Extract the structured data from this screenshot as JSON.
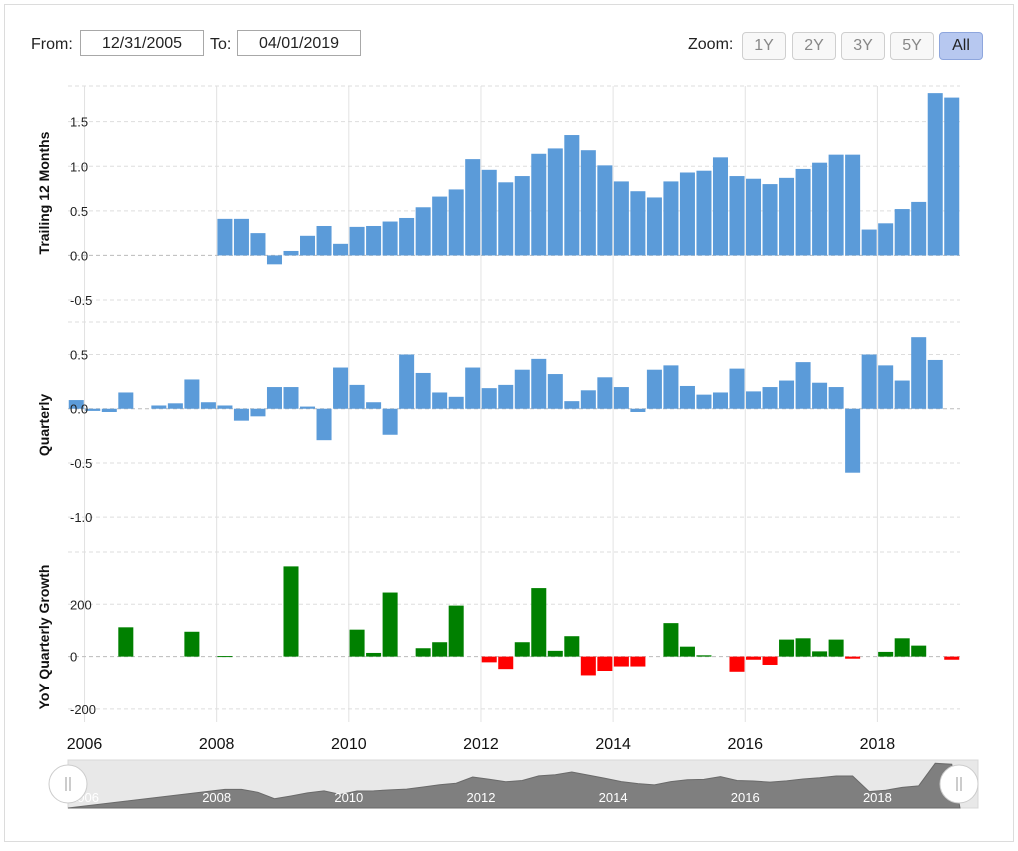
{
  "range": {
    "from_label": "From:",
    "from_value": "12/31/2005",
    "to_label": "To:",
    "to_value": "04/01/2019"
  },
  "zoom": {
    "label": "Zoom:",
    "buttons": [
      "1Y",
      "2Y",
      "3Y",
      "5Y",
      "All"
    ],
    "selected": "All"
  },
  "colors": {
    "blue_bars": "#5b9bd9",
    "positive": "#008000",
    "negative": "#ff0000",
    "grid": "#dddddd",
    "navigator_area": "#7f7f7f"
  },
  "chart_data": {
    "type": "bar",
    "x_start_year": 2005.75,
    "x_end_year": 2019.25,
    "bar_step_years": 0.25,
    "x_ticks": [
      "2006",
      "2008",
      "2010",
      "2012",
      "2014",
      "2016",
      "2018"
    ],
    "panels": [
      {
        "ylabel": "Trailing 12 Months",
        "ylim": [
          -0.5,
          1.9
        ],
        "yticks": [
          1.5,
          1.0,
          0.5,
          0.0,
          -0.5
        ],
        "ytick_labels": [
          "1.5",
          "1.0",
          "0.5",
          "0.0",
          "-0.5"
        ],
        "values": [
          null,
          null,
          null,
          null,
          null,
          null,
          null,
          null,
          null,
          0.41,
          0.41,
          0.25,
          -0.1,
          0.05,
          0.22,
          0.33,
          0.13,
          0.32,
          0.33,
          0.38,
          0.42,
          0.54,
          0.66,
          0.74,
          1.08,
          0.96,
          0.82,
          0.89,
          1.14,
          1.2,
          1.35,
          1.18,
          1.01,
          0.83,
          0.72,
          0.65,
          0.83,
          0.93,
          0.95,
          1.1,
          0.89,
          0.86,
          0.8,
          0.87,
          0.97,
          1.04,
          1.13,
          1.13,
          0.29,
          0.36,
          0.52,
          0.6,
          1.82,
          1.77
        ]
      },
      {
        "ylabel": "Quarterly",
        "ylim": [
          -1.1,
          0.8
        ],
        "yticks": [
          0.5,
          0.0,
          -0.5,
          -1.0
        ],
        "ytick_labels": [
          "0.5",
          "0.0",
          "-0.5",
          "-1.0"
        ],
        "values": [
          0.08,
          -0.02,
          -0.03,
          0.15,
          null,
          0.03,
          0.05,
          0.27,
          0.06,
          0.03,
          -0.11,
          -0.07,
          0.2,
          0.2,
          0.02,
          -0.29,
          0.38,
          0.22,
          0.06,
          -0.24,
          0.5,
          0.33,
          0.15,
          0.11,
          0.38,
          0.19,
          0.22,
          0.36,
          0.46,
          0.32,
          0.07,
          0.17,
          0.29,
          0.2,
          -0.03,
          0.36,
          0.4,
          0.21,
          0.13,
          0.15,
          0.37,
          0.16,
          0.2,
          0.26,
          0.43,
          0.24,
          0.2,
          -0.59,
          0.5,
          0.4,
          0.26,
          0.66,
          0.45
        ]
      },
      {
        "ylabel": "YoY Quarterly Growth",
        "ylim": [
          -250,
          400
        ],
        "yticks": [
          200,
          0,
          -200
        ],
        "ytick_labels": [
          "200",
          "0",
          "-200"
        ],
        "values": [
          null,
          null,
          null,
          112,
          null,
          null,
          null,
          95,
          null,
          2,
          null,
          null,
          null,
          345,
          null,
          null,
          null,
          103,
          14,
          245,
          null,
          32,
          55,
          195,
          null,
          -22,
          -48,
          55,
          262,
          22,
          78,
          -72,
          -55,
          -38,
          -38,
          null,
          128,
          38,
          5,
          null,
          -58,
          -12,
          -32,
          65,
          70,
          20,
          65,
          -8,
          null,
          18,
          70,
          42,
          null,
          -12
        ]
      }
    ],
    "navigator_labels": [
      "2006",
      "2008",
      "2010",
      "2012",
      "2014",
      "2016",
      "2018"
    ]
  }
}
